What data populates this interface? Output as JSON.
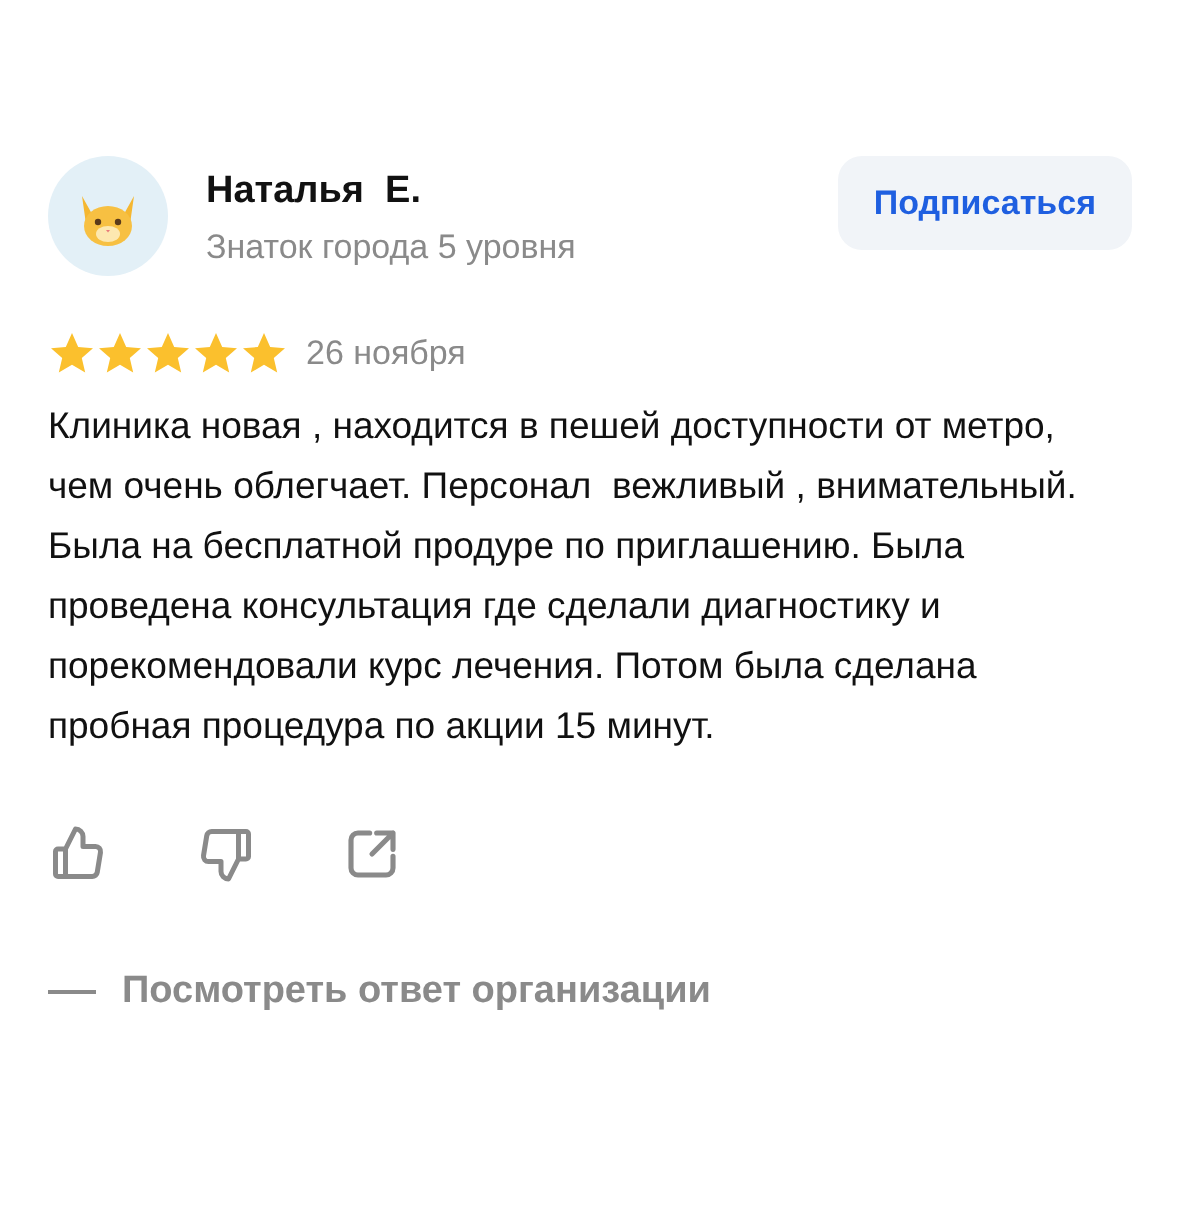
{
  "author": {
    "name": "Наталья  Е.",
    "level": "Знаток города 5 уровня"
  },
  "subscribe_button": "Подписаться",
  "rating": {
    "stars": 5
  },
  "date": "26 ноября",
  "text": "Клиника новая , находится в пешей доступности от метро, чем очень облегчает. Персонал  вежливый , внимательный. Была на бесплатной продуре по приглашению. Была проведена консультация где сделали диагностику и порекомендовали курс лечения. Потом была сделана пробная процедура по акции 15 минут.",
  "reply_link": "Посмотреть ответ организации"
}
